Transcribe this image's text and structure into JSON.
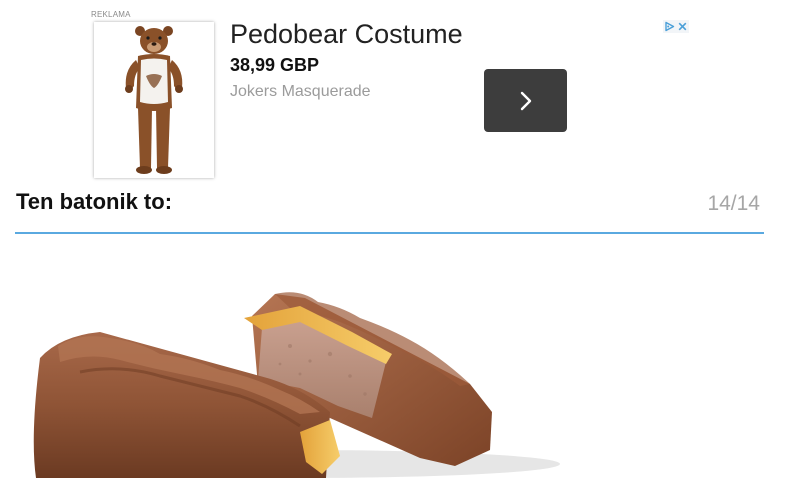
{
  "ad": {
    "label": "REKLAMA",
    "product_title": "Pedobear Costume",
    "price": "38,99 GBP",
    "advertiser": "Jokers Masquerade",
    "image_icon": "bear-costume-image",
    "next_icon": "chevron-right-icon",
    "adchoices_icons": [
      "adchoices-play-icon",
      "adchoices-close-icon"
    ],
    "colors": {
      "next_button_bg": "#3d3d3d",
      "adchoices": "#4a9fd8"
    }
  },
  "quiz": {
    "question": "Ten batonik to:",
    "progress": "14/14",
    "image_icon": "chocolate-bar-image",
    "colors": {
      "divider": "#5aa9e0",
      "counter": "#a6a6a6"
    }
  }
}
